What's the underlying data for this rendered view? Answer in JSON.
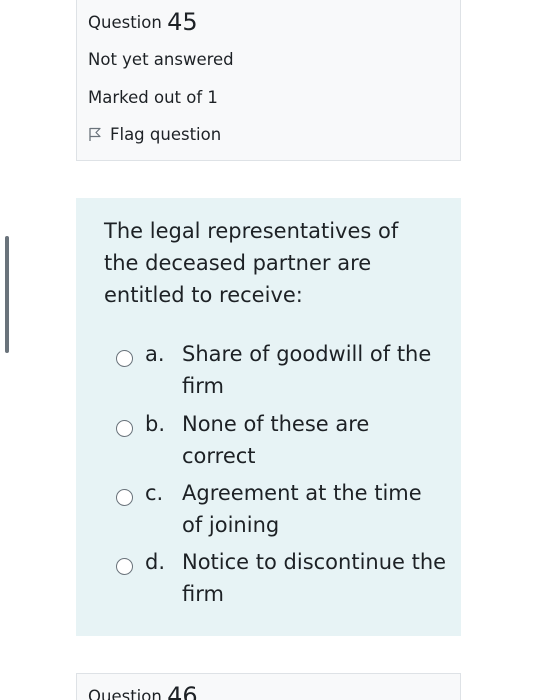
{
  "info": {
    "question_label": "Question",
    "question_number": "45",
    "state": "Not yet answered",
    "grade": "Marked out of 1",
    "flag_label": "Flag question"
  },
  "question": {
    "text": "The legal representatives of the deceased partner are entitled to receive:",
    "answers": [
      {
        "letter": "a.",
        "text": "Share of goodwill of the firm"
      },
      {
        "letter": "b.",
        "text": "None of these are correct"
      },
      {
        "letter": "c.",
        "text": "Agreement at the time of joining"
      },
      {
        "letter": "d.",
        "text": "Notice to discontinue the firm"
      }
    ]
  },
  "next": {
    "question_label": "Question",
    "question_number": "46"
  },
  "icons": {
    "flag": "flag-outline-icon",
    "radio": "radio-unchecked-icon"
  }
}
